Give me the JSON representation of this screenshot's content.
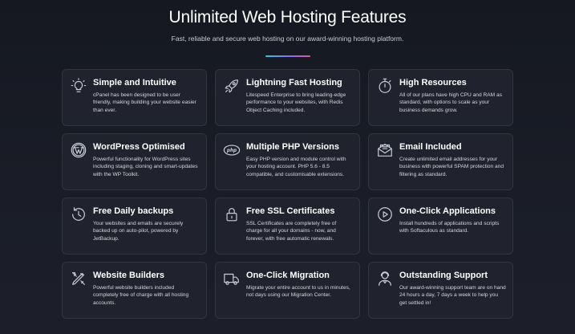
{
  "header": {
    "title": "Unlimited Web Hosting Features",
    "subtitle": "Fast, reliable and secure web hosting on our award-winning hosting platform."
  },
  "features": [
    {
      "icon": "lightbulb-icon",
      "title": "Simple and Intuitive",
      "description": "cPanel has been designed to be user friendly, making building your website easier than ever."
    },
    {
      "icon": "rocket-icon",
      "title": "Lightning Fast Hosting",
      "description": "Litespeed Enterprise to bring leading-edge performance to your websites, with Redis Object Caching included."
    },
    {
      "icon": "stopwatch-icon",
      "title": "High Resources",
      "description": "All of our plans have high CPU and RAM as standard, with options to scale as your business demands grow."
    },
    {
      "icon": "wordpress-icon",
      "title": "WordPress Optimised",
      "description": "Powerful functionality for WordPress sites including staging, cloning and smart-updates with the WP Toolkit."
    },
    {
      "icon": "php-icon",
      "title": "Multiple PHP Versions",
      "description": "Easy PHP version and module control with your hosting account. PHP 5.6 - 8.5 compatible, and customisable extensions."
    },
    {
      "icon": "envelope-icon",
      "title": "Email Included",
      "description": "Create unlimited email addresses for your business with powerful SPAM protection and filtering as standard."
    },
    {
      "icon": "history-icon",
      "title": "Free Daily backups",
      "description": "Your websites and emails are securely backed up on auto-pilot, powered by JetBackup."
    },
    {
      "icon": "lock-icon",
      "title": "Free SSL Certificates",
      "description": "SSL Certificates are completely free of charge for all your domains - now, and forever, with free automatic renewals."
    },
    {
      "icon": "play-circle-icon",
      "title": "One-Click Applications",
      "description": "Install hundreds of applications and scripts with Softaculous as standard."
    },
    {
      "icon": "design-tools-icon",
      "title": "Website Builders",
      "description": "Powerful website builders included completely free of charge with all hosting accounts."
    },
    {
      "icon": "truck-icon",
      "title": "One-Click Migration",
      "description": "Migrate your entire account to us in minutes, not days using our Migration Center."
    },
    {
      "icon": "support-agent-icon",
      "title": "Outstanding Support",
      "description": "Our award-winning support team are on hand 24 hours a day, 7 days a week to help you get settled in!"
    }
  ],
  "colors": {
    "background": "#181b24",
    "card": "#20232d",
    "card_border": "#31353f",
    "icon": "#c8ccd6",
    "accent_gradient": [
      "#2ec4d6",
      "#8b6cf0",
      "#e0589c"
    ]
  }
}
